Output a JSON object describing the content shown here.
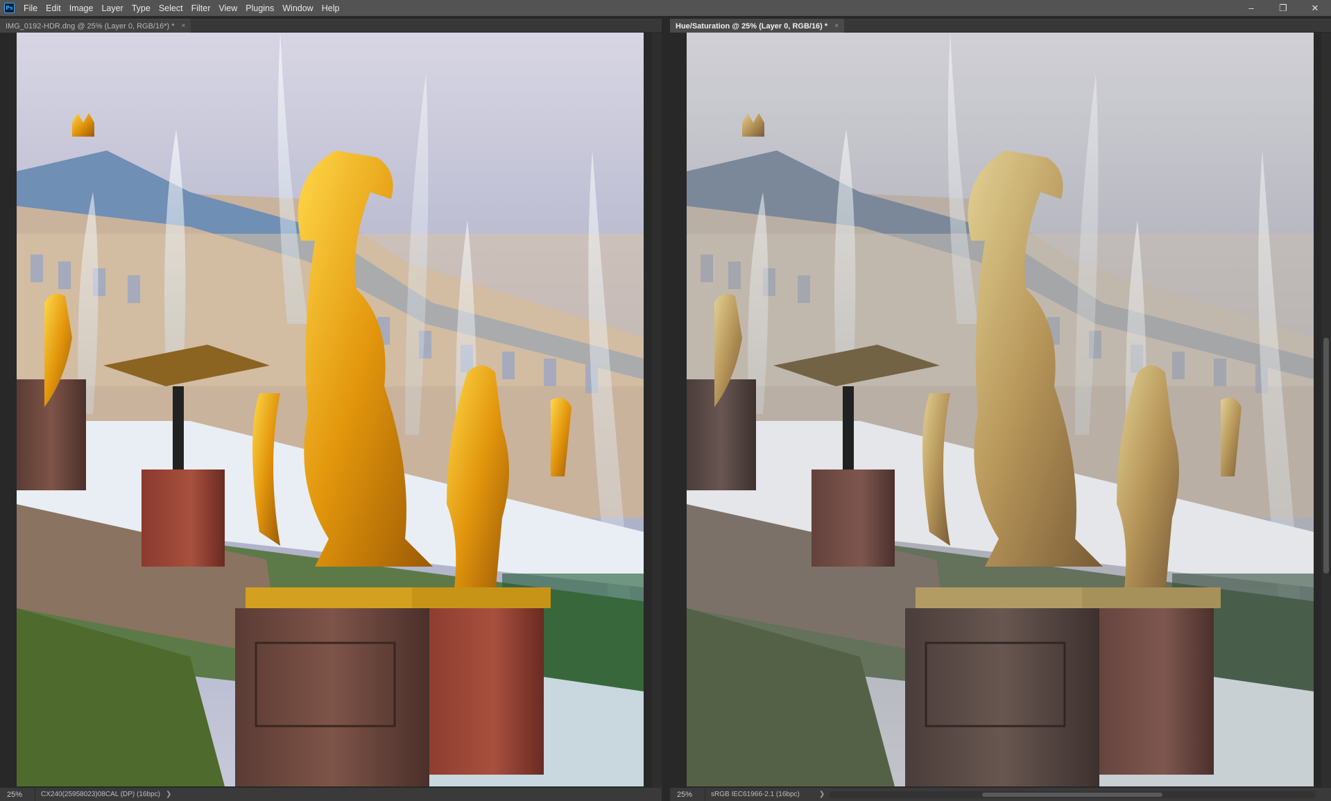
{
  "app": {
    "logo": "Ps"
  },
  "menu": [
    "File",
    "Edit",
    "Image",
    "Layer",
    "Type",
    "Select",
    "Filter",
    "View",
    "Plugins",
    "Window",
    "Help"
  ],
  "window_controls": {
    "minimize": "–",
    "maximize": "❐",
    "close": "✕"
  },
  "docs": [
    {
      "tab_title": "IMG_0192-HDR.dng @ 25% (Layer 0, RGB/16*) *",
      "zoom": "25%",
      "profile": "CX240(25958023)08CAL (DP) (16bpc)",
      "variant": "original"
    },
    {
      "tab_title": "Hue/Saturation @ 25% (Layer 0, RGB/16) *",
      "zoom": "25%",
      "profile": "sRGB IEC61966-2.1 (16bpc)",
      "variant": "desaturated"
    }
  ],
  "icons": {
    "close_tab": "×",
    "status_arrow": "❯"
  },
  "colors": {
    "menubar": "#535353",
    "workspace": "#282828",
    "tab_active": "#4a4a4a",
    "accent": "#31a8ff"
  }
}
